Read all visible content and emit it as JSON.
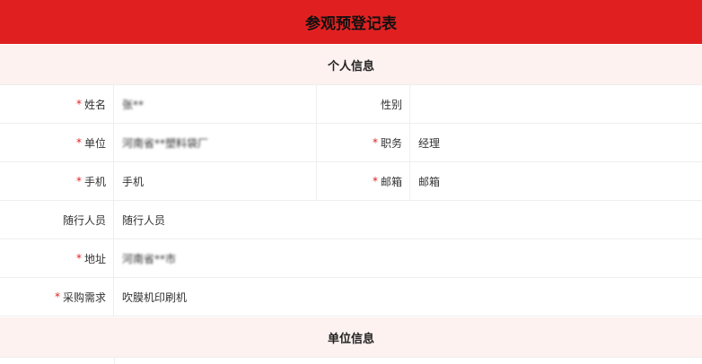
{
  "page": {
    "title": "参观预登记表"
  },
  "sections": {
    "personal": "个人信息",
    "company": "单位信息"
  },
  "fields": {
    "name": {
      "label": "姓名",
      "value": "张**"
    },
    "gender": {
      "label": "性别",
      "value": ""
    },
    "company": {
      "label": "单位",
      "value": "河南省**塑料袋厂"
    },
    "position": {
      "label": "职务",
      "value": "经理"
    },
    "phone": {
      "label": "手机",
      "value": "手机"
    },
    "email": {
      "label": "邮箱",
      "value": "邮箱"
    },
    "companions": {
      "label": "随行人员",
      "value": "随行人员"
    },
    "address": {
      "label": "地址",
      "value": "河南省**市"
    },
    "purchase": {
      "label": "采购需求",
      "value": "吹膜机印刷机"
    }
  },
  "required_mark": "*",
  "colors": {
    "accent": "#e02020",
    "section_bg": "#fdf2f0"
  }
}
